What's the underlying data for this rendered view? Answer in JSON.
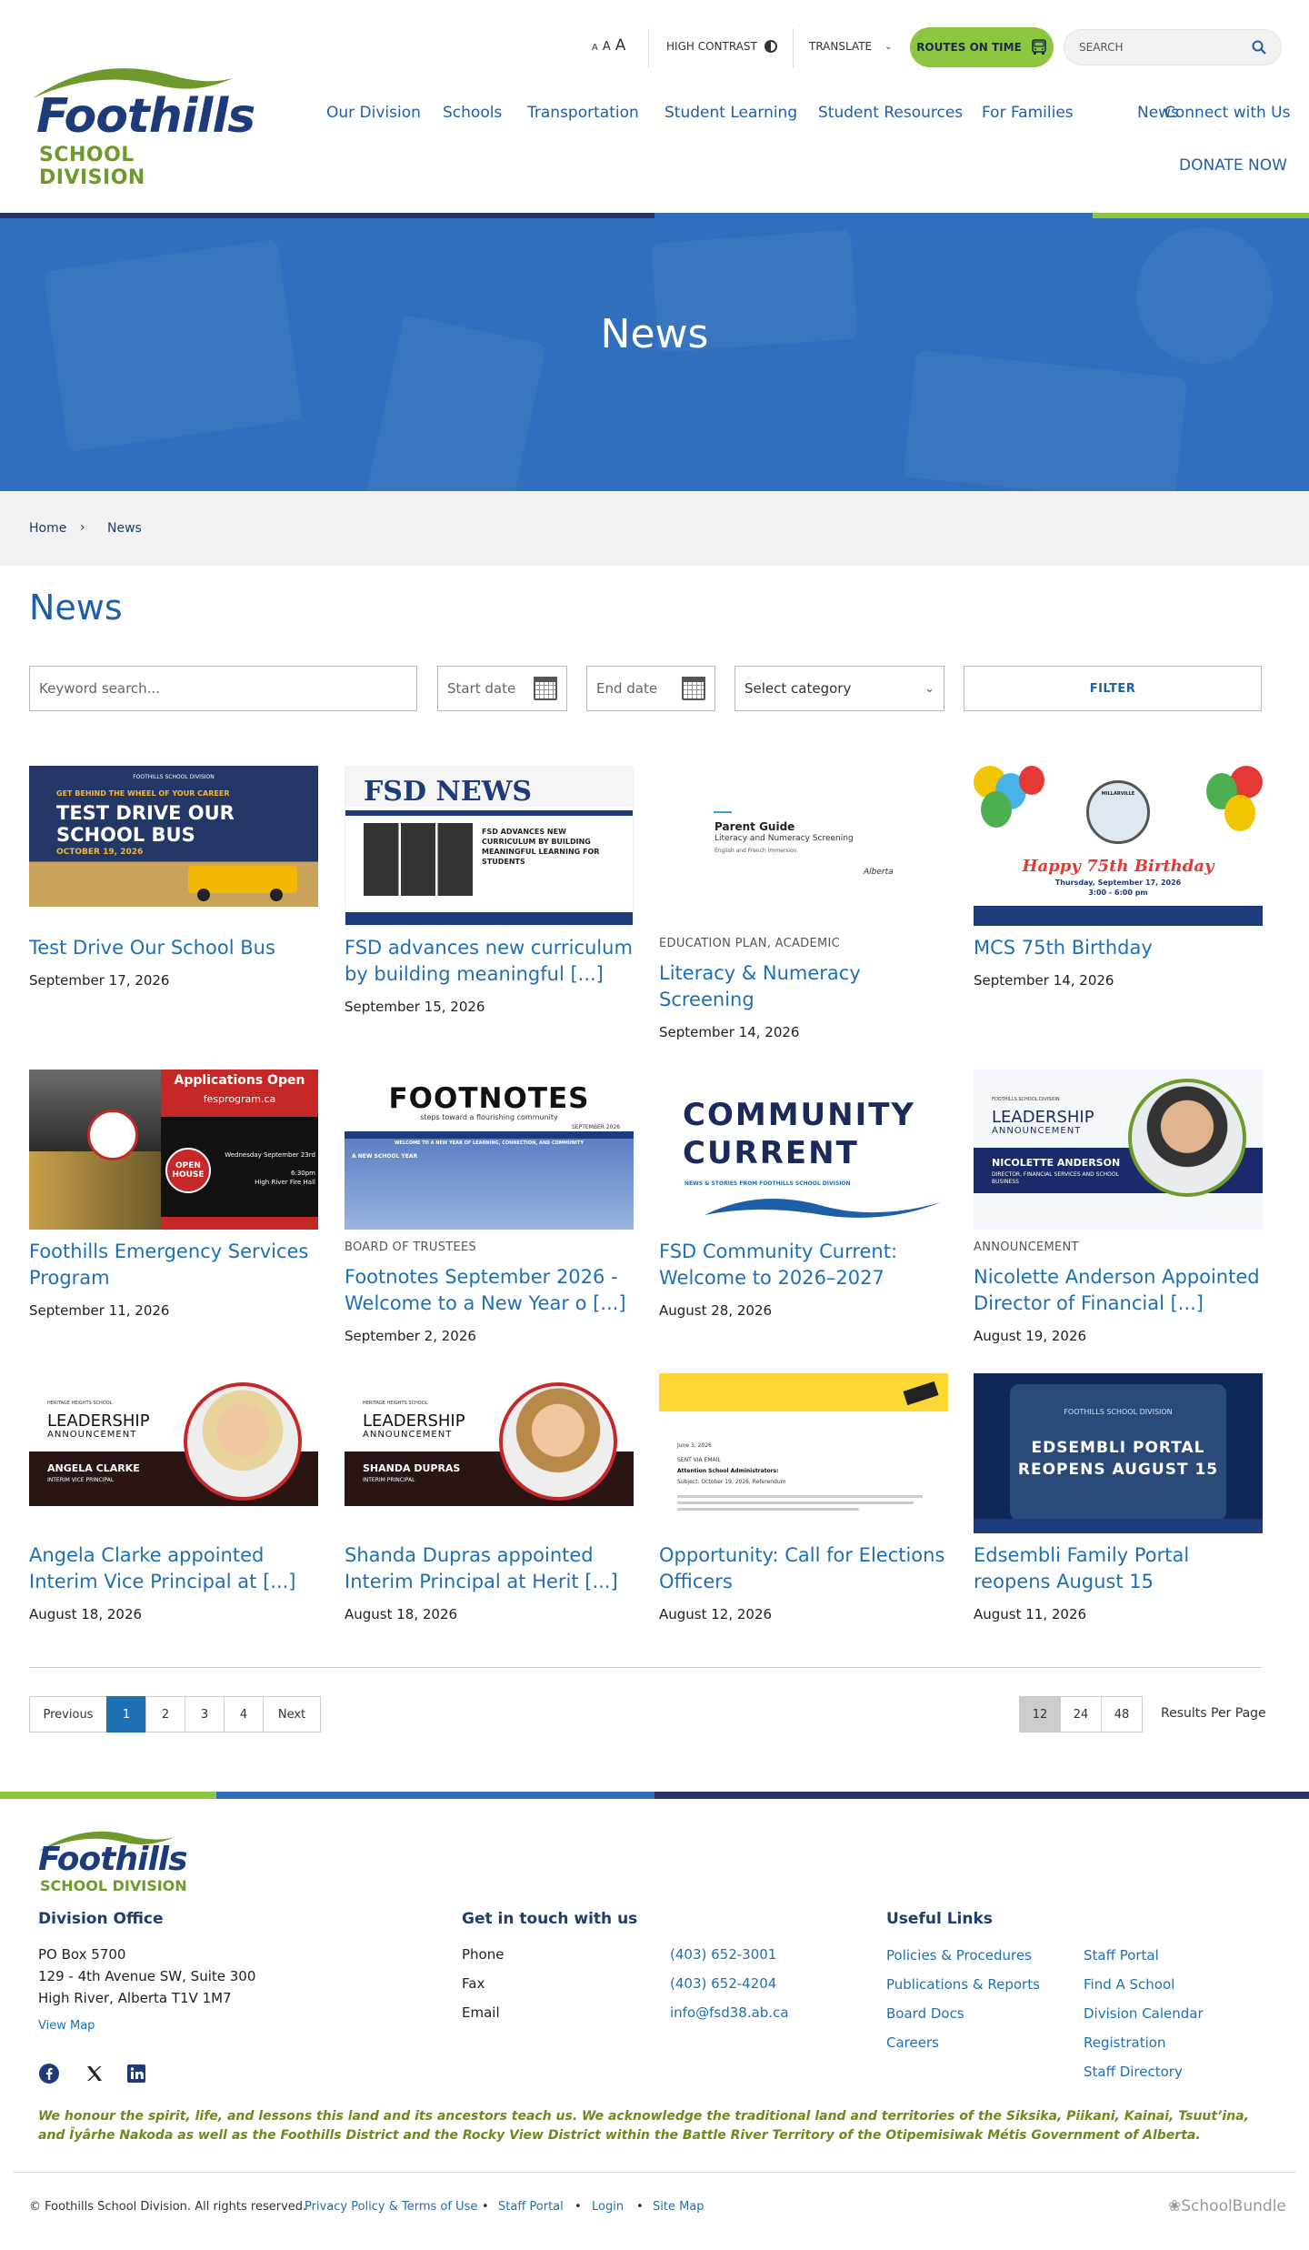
{
  "header": {
    "logo": {
      "word": "Foothills",
      "sub": "SCHOOL DIVISION"
    },
    "font_size_labels": [
      "A",
      "A",
      "A"
    ],
    "high_contrast": "HIGH CONTRAST",
    "translate": "TRANSLATE",
    "routes": "ROUTES ON TIME",
    "search_placeholder": "SEARCH",
    "nav": [
      "Our Division",
      "Schools",
      "Transportation",
      "Student Learning",
      "Student Resources",
      "For Families",
      "News",
      "Connect with Us"
    ],
    "donate": "DONATE NOW"
  },
  "hero": {
    "title": "News"
  },
  "breadcrumb": {
    "home": "Home",
    "current": "News"
  },
  "page_title": "News",
  "filters": {
    "keyword_placeholder": "Keyword search...",
    "start_placeholder": "Start date",
    "end_placeholder": "End date",
    "category": "Select category",
    "filter_button": "FILTER"
  },
  "articles": [
    {
      "category": "",
      "title": "Test Drive Our School Bus",
      "date": "September 17, 2026",
      "thumb": {
        "line1": "GET BEHIND THE WHEEL OF YOUR CAREER",
        "line2": "TEST DRIVE OUR",
        "line3": "SCHOOL BUS",
        "line4": "OCTOBER 19, 2026",
        "top": "FOOTHILLS SCHOOL DIVISION"
      }
    },
    {
      "category": "",
      "title": "FSD advances new curriculum by building meaningful [...]",
      "date": "September 15, 2026",
      "thumb": {
        "line1": "FSD NEWS",
        "line2": "FSD ADVANCES NEW CURRICULUM BY BUILDING MEANINGFUL LEARNING FOR STUDENTS"
      }
    },
    {
      "category": "EDUCATION PLAN, ACADEMIC",
      "title": "Literacy & Numeracy Screening",
      "date": "September 14, 2026",
      "thumb": {
        "line1": "Parent Guide",
        "line2": "Literacy and Numeracy Screening",
        "line3": "English and French Immersion",
        "line4": "Alberta"
      }
    },
    {
      "category": "",
      "title": "MCS 75th Birthday",
      "date": "September 14, 2026",
      "thumb": {
        "line1": "MILLARVILLE",
        "line2": "Happy 75th Birthday",
        "line3": "Thursday, September 17, 2026",
        "line4": "3:00 - 6:00 pm"
      }
    },
    {
      "category": "",
      "title": "Foothills Emergency Services Program",
      "date": "September 11, 2026",
      "thumb": {
        "line1": "Applications Open",
        "line2": "fesprogram.ca",
        "line3": "OPEN HOUSE",
        "line4": "Wednesday September 23rd",
        "line5": "6:30pm",
        "line6": "High River Fire Hall"
      }
    },
    {
      "category": "BOARD OF TRUSTEES",
      "title": "Footnotes September 2026 - Welcome to a New Year o [...]",
      "date": "September 2, 2026",
      "thumb": {
        "line1": "FOOTNOTES",
        "line2": "steps toward a flourishing community",
        "line3": "SEPTEMBER 2026",
        "line4": "WELCOME TO A NEW YEAR OF LEARNING, CONNECTION, AND COMMUNITY",
        "line5": "A NEW SCHOOL YEAR"
      }
    },
    {
      "category": "",
      "title": "FSD Community Current: Welcome to 2026–2027",
      "date": "August 28, 2026",
      "thumb": {
        "line1": "COMMUNITY",
        "line2": "CURRENT",
        "line3": "NEWS & STORIES FROM FOOTHILLS SCHOOL DIVISION"
      }
    },
    {
      "category": "ANNOUNCEMENT",
      "title": "Nicolette Anderson Appointed Director of Financial [...]",
      "date": "August 19, 2026",
      "thumb": {
        "top": "FOOTHILLS SCHOOL DIVISION",
        "line1": "LEADERSHIP",
        "line2": "ANNOUNCEMENT",
        "line3": "NICOLETTE ANDERSON",
        "line4": "DIRECTOR, FINANCIAL SERVICES AND SCHOOL BUSINESS"
      }
    },
    {
      "category": "",
      "title": "Angela Clarke appointed Interim Vice Principal at [...]",
      "date": "August 18, 2026",
      "thumb": {
        "top": "HERITAGE HEIGHTS SCHOOL",
        "line1": "LEADERSHIP",
        "line2": "ANNOUNCEMENT",
        "line3": "ANGELA CLARKE",
        "line4": "INTERIM VICE PRINCIPAL"
      }
    },
    {
      "category": "",
      "title": "Shanda Dupras appointed Interim Principal at Herit [...]",
      "date": "August 18, 2026",
      "thumb": {
        "top": "HERITAGE HEIGHTS SCHOOL",
        "line1": "LEADERSHIP",
        "line2": "ANNOUNCEMENT",
        "line3": "SHANDA DUPRAS",
        "line4": "INTERIM PRINCIPAL"
      }
    },
    {
      "category": "",
      "title": "Opportunity: Call for Elections Officers",
      "date": "August 12, 2026",
      "thumb": {
        "line1": "June 3, 2026",
        "line2": "SENT VIA EMAIL",
        "line3": "Attention School Administrators:",
        "line4": "Subject: October 19, 2026, Referendum"
      }
    },
    {
      "category": "",
      "title": "Edsembli Family Portal reopens August 15",
      "date": "August 11, 2026",
      "thumb": {
        "top": "FOOTHILLS SCHOOL DIVISION",
        "line1": "EDSEMBLI PORTAL",
        "line2": "REOPENS AUGUST 15"
      }
    }
  ],
  "pagination": {
    "previous": "Previous",
    "pages": [
      "1",
      "2",
      "3",
      "4"
    ],
    "next": "Next",
    "per_page": [
      "12",
      "24",
      "48"
    ],
    "per_page_label": "Results Per Page"
  },
  "footer": {
    "logo": {
      "word": "Foothills",
      "sub": "SCHOOL DIVISION"
    },
    "office_heading": "Division Office",
    "address": [
      "PO Box 5700",
      "129 - 4th Avenue SW, Suite 300",
      "High River, Alberta T1V 1M7"
    ],
    "view_map": "View Map",
    "contact_heading": "Get in touch with us",
    "contact": [
      {
        "label": "Phone",
        "value": "(403) 652-3001"
      },
      {
        "label": "Fax",
        "value": "(403) 652-4204"
      },
      {
        "label": "Email",
        "value": "info@fsd38.ab.ca"
      }
    ],
    "links_heading": "Useful Links",
    "links_col1": [
      "Policies & Procedures",
      "Publications & Reports",
      "Board Docs",
      "Careers"
    ],
    "links_col2": [
      "Staff Portal",
      "Find A School",
      "Division Calendar",
      "Registration",
      "Staff Directory"
    ],
    "acknowledgement": "We honour the spirit, life, and lessons this land and its ancestors teach us. We acknowledge the traditional land and territories of the Siksika, Piikani, Kainai, Tsuut’ina, and Îyârhe Nakoda as well as the Foothills District and the Rocky View District within the Battle River Territory of the Otipemisiwak Métis Government of Alberta.",
    "copyright": "© Foothills School Division. All rights reserved.",
    "bottom_links": [
      "Privacy Policy & Terms of Use",
      "Staff Portal",
      "Login",
      "Site Map"
    ],
    "bullet": "•",
    "credit": "SchoolBundle"
  },
  "colors": {
    "primary_blue": "#1f6fb5",
    "navy": "#1d3b7a",
    "green": "#8dc63f",
    "hero_blue": "#2f6fbd"
  }
}
